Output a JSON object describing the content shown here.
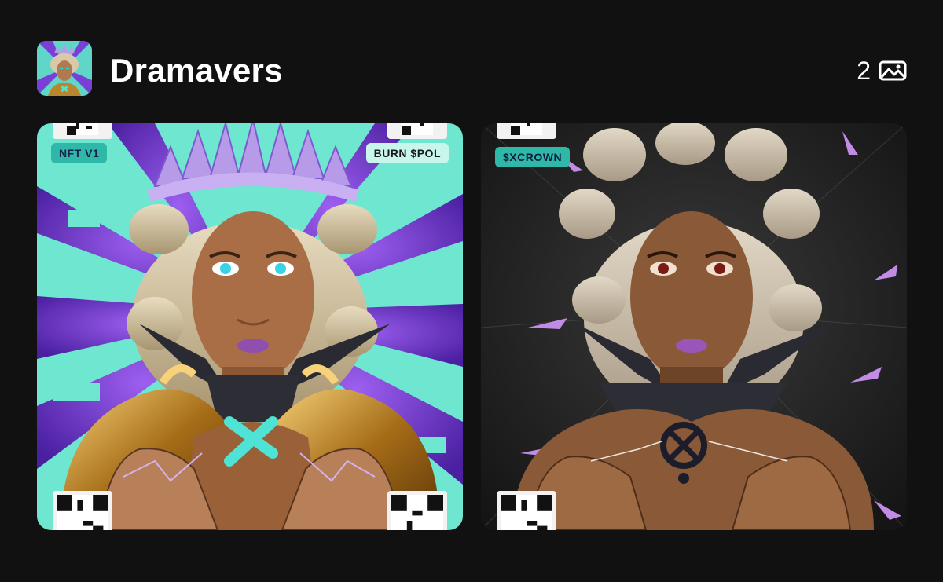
{
  "collection": {
    "name": "Dramavers",
    "item_count": "2",
    "count_icon": "gallery-icon"
  },
  "cards": [
    {
      "tags": [
        "NFT V1",
        "BURN $POL"
      ],
      "accent": "#6ee6d0",
      "secondary": "#7a3fd1"
    },
    {
      "tags": [
        "$XCROWN"
      ],
      "accent": "#2b2b2b",
      "secondary": "#c18be6"
    }
  ]
}
